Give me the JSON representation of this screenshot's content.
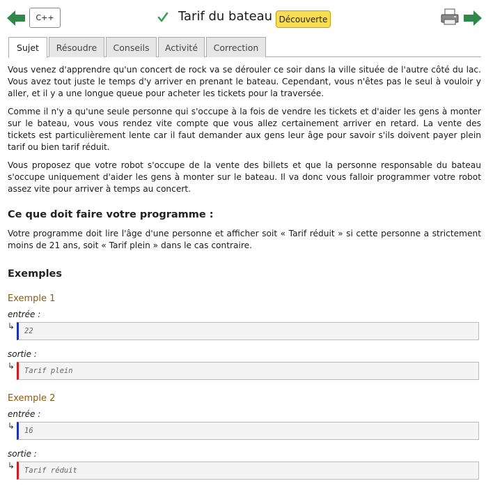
{
  "header": {
    "language_button": "C++",
    "title": "Tarif du bateau",
    "level_badge": "Découverte",
    "icons": {
      "prev": "arrow-left-icon",
      "solved": "check-icon",
      "print": "printer-icon",
      "next": "arrow-right-icon"
    },
    "colors": {
      "arrow": "#2f8a4a",
      "check": "#3aa04a",
      "badge": "#f7dc54"
    }
  },
  "tabs": [
    {
      "label": "Sujet",
      "active": true
    },
    {
      "label": "Résoudre",
      "active": false
    },
    {
      "label": "Conseils",
      "active": false
    },
    {
      "label": "Activité",
      "active": false
    },
    {
      "label": "Correction",
      "active": false
    }
  ],
  "statement": {
    "paragraphs": [
      "Vous venez d'apprendre qu'un concert de rock va se dérouler ce soir dans la ville située de l'autre côté du lac. Vous avez tout juste le temps d'y arriver en prenant le bateau. Cependant, vous n'êtes pas le seul à vouloir y aller, et il y a une longue queue pour acheter les tickets pour la traversée.",
      "Comme il n'y a qu'une seule personne qui s'occupe à la fois de vendre les tickets et d'aider les gens à monter sur le bateau, vous vous rendez vite compte que vous allez certainement arriver en retard. La vente des tickets est particulièrement lente car il faut demander aux gens leur âge pour savoir s'ils doivent payer plein tarif ou bien tarif réduit.",
      "Vous proposez que votre robot s'occupe de la vente des billets et que la personne responsable du bateau s'occupe uniquement d'aider les gens à monter sur le bateau. Il va donc vous falloir programmer votre robot assez vite pour arriver à temps au concert."
    ],
    "task_heading": "Ce que doit faire votre programme :",
    "task_text": "Votre programme doit lire l'âge d'une personne et afficher soit « Tarif réduit » si cette personne a strictement moins de 21 ans, soit « Tarif plein » dans le cas contraire.",
    "examples_heading": "Exemples"
  },
  "examples": [
    {
      "title": "Exemple 1",
      "input_label": "entrée :",
      "input": "22",
      "output_label": "sortie :",
      "output": "Tarif plein"
    },
    {
      "title": "Exemple 2",
      "input_label": "entrée :",
      "input": "16",
      "output_label": "sortie :",
      "output": "Tarif réduit"
    }
  ],
  "io_arrow_glyph": "↳"
}
